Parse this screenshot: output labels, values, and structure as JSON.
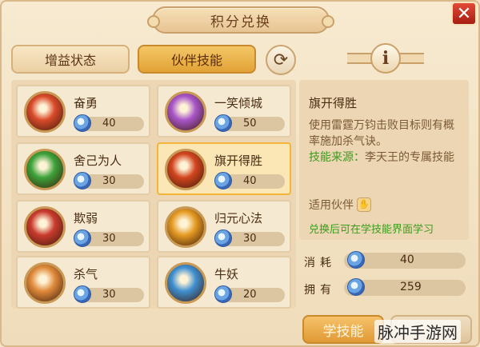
{
  "header": {
    "title": "积分兑换",
    "close_label": "✕"
  },
  "tabs": [
    {
      "label": "增益状态",
      "active": false
    },
    {
      "label": "伙伴技能",
      "active": true
    }
  ],
  "refresh_icon": "refresh-icon",
  "info_icon": {
    "name": "info-icon",
    "glyph": "i"
  },
  "skills": [
    {
      "name": "奋勇",
      "cost": "40",
      "icon_color": "#d94a2a"
    },
    {
      "name": "一笑倾城",
      "cost": "50",
      "icon_color": "#a855c9"
    },
    {
      "name": "舍己为人",
      "cost": "30",
      "icon_color": "#3da23a"
    },
    {
      "name": "旗开得胜",
      "cost": "40",
      "icon_color": "#d2451f",
      "selected": true
    },
    {
      "name": "欺弱",
      "cost": "30",
      "icon_color": "#c93b2d"
    },
    {
      "name": "归元心法",
      "cost": "30",
      "icon_color": "#e59a22"
    },
    {
      "name": "杀气",
      "cost": "30",
      "icon_color": "#e08a3a"
    },
    {
      "name": "牛妖",
      "cost": "20",
      "icon_color": "#3f8fd0"
    }
  ],
  "detail": {
    "title": "旗开得胜",
    "description": "使用雷霆万钧击败目标则有概率施加杀气诀。",
    "source_label": "技能来源：",
    "source_value": "李天王的专属技能",
    "partner_label": "适用伙伴",
    "exchange_note": "兑换后可在学技能界面学习"
  },
  "consume": {
    "label": "消耗",
    "value": "40"
  },
  "own": {
    "label": "拥有",
    "value": "259"
  },
  "learn_button": "学技能",
  "watermark": "脉冲手游网",
  "colors": {
    "accent": "#f2b539",
    "green_text": "#3e9b1d",
    "gem": "#3867b8"
  }
}
